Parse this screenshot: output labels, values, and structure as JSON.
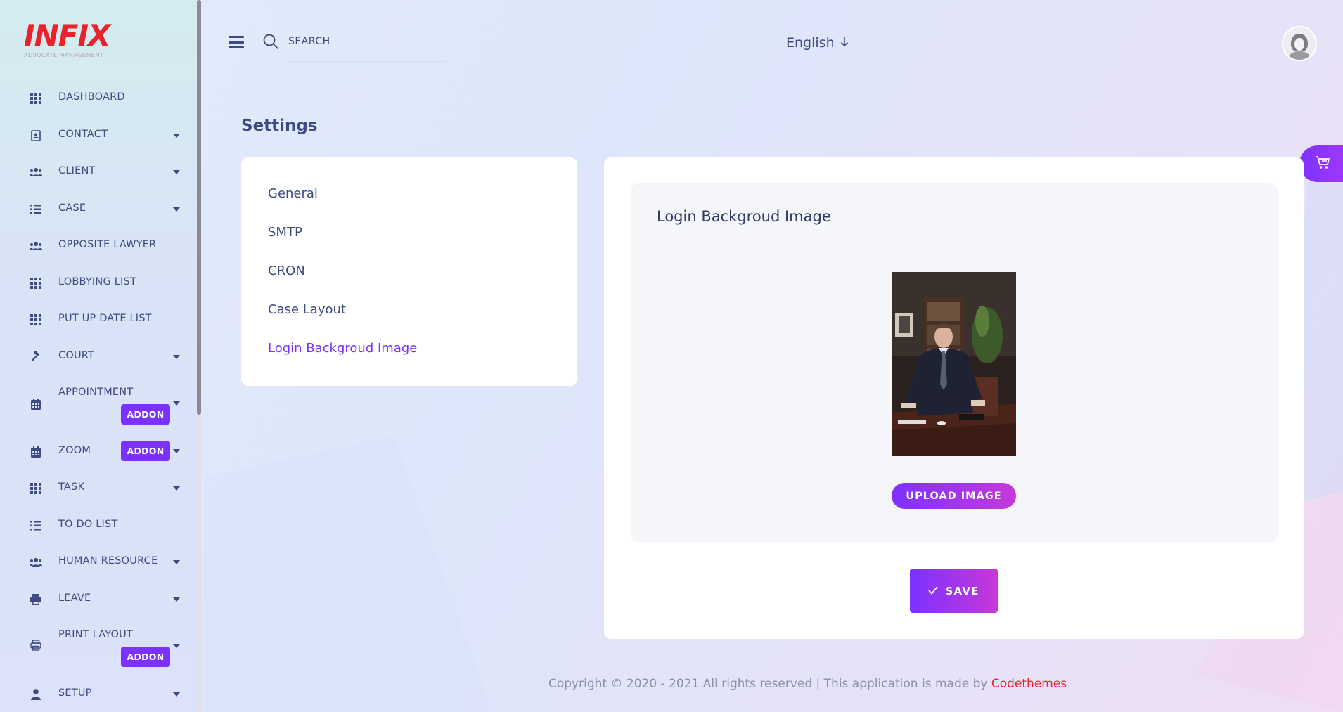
{
  "brand": {
    "logo_text": "INFIX",
    "tagline": "ADVOCATE MANAGEMENT",
    "logo_color": "#e8242b"
  },
  "colors": {
    "accent": "#7c32ff",
    "accent_gradient_end": "#c738d8",
    "text": "#3e4a82"
  },
  "sidebar": {
    "items": [
      {
        "label": "DASHBOARD",
        "icon": "grid-icon",
        "has_caret": false
      },
      {
        "label": "CONTACT",
        "icon": "address-book-icon",
        "has_caret": true
      },
      {
        "label": "CLIENT",
        "icon": "users-icon",
        "has_caret": true
      },
      {
        "label": "CASE",
        "icon": "list-icon",
        "has_caret": true
      },
      {
        "label": "OPPOSITE LAWYER",
        "icon": "users-icon",
        "has_caret": false
      },
      {
        "label": "LOBBYING LIST",
        "icon": "grid-icon",
        "has_caret": false
      },
      {
        "label": "PUT UP DATE LIST",
        "icon": "grid-icon",
        "has_caret": false
      },
      {
        "label": "COURT",
        "icon": "gavel-icon",
        "has_caret": true
      },
      {
        "label": "APPOINTMENT",
        "icon": "calendar-icon",
        "has_caret": true,
        "badge": "ADDON"
      },
      {
        "label": "ZOOM",
        "icon": "calendar-icon",
        "has_caret": true,
        "badge": "ADDON"
      },
      {
        "label": "TASK",
        "icon": "grid-icon",
        "has_caret": true
      },
      {
        "label": "TO DO LIST",
        "icon": "list-icon",
        "has_caret": false
      },
      {
        "label": "HUMAN RESOURCE",
        "icon": "users-icon",
        "has_caret": true
      },
      {
        "label": "LEAVE",
        "icon": "printer-icon",
        "has_caret": true
      },
      {
        "label": "PRINT LAYOUT",
        "icon": "print-outline-icon",
        "has_caret": true,
        "badge": "ADDON"
      },
      {
        "label": "SETUP",
        "icon": "user-icon",
        "has_caret": true
      }
    ]
  },
  "topbar": {
    "search_placeholder": "SEARCH",
    "language": "English"
  },
  "main": {
    "page_title": "Settings",
    "settings_nav": [
      {
        "label": "General",
        "active": false
      },
      {
        "label": "SMTP",
        "active": false
      },
      {
        "label": "CRON",
        "active": false
      },
      {
        "label": "Case Layout",
        "active": false
      },
      {
        "label": "Login Backgroud Image",
        "active": true
      }
    ],
    "panel_title": "Login Backgroud Image",
    "upload_label": "UPLOAD IMAGE",
    "save_label": "SAVE"
  },
  "footer": {
    "text": "Copyright © 2020 - 2021 All rights reserved | This application is made by ",
    "brand": "Codethemes"
  }
}
